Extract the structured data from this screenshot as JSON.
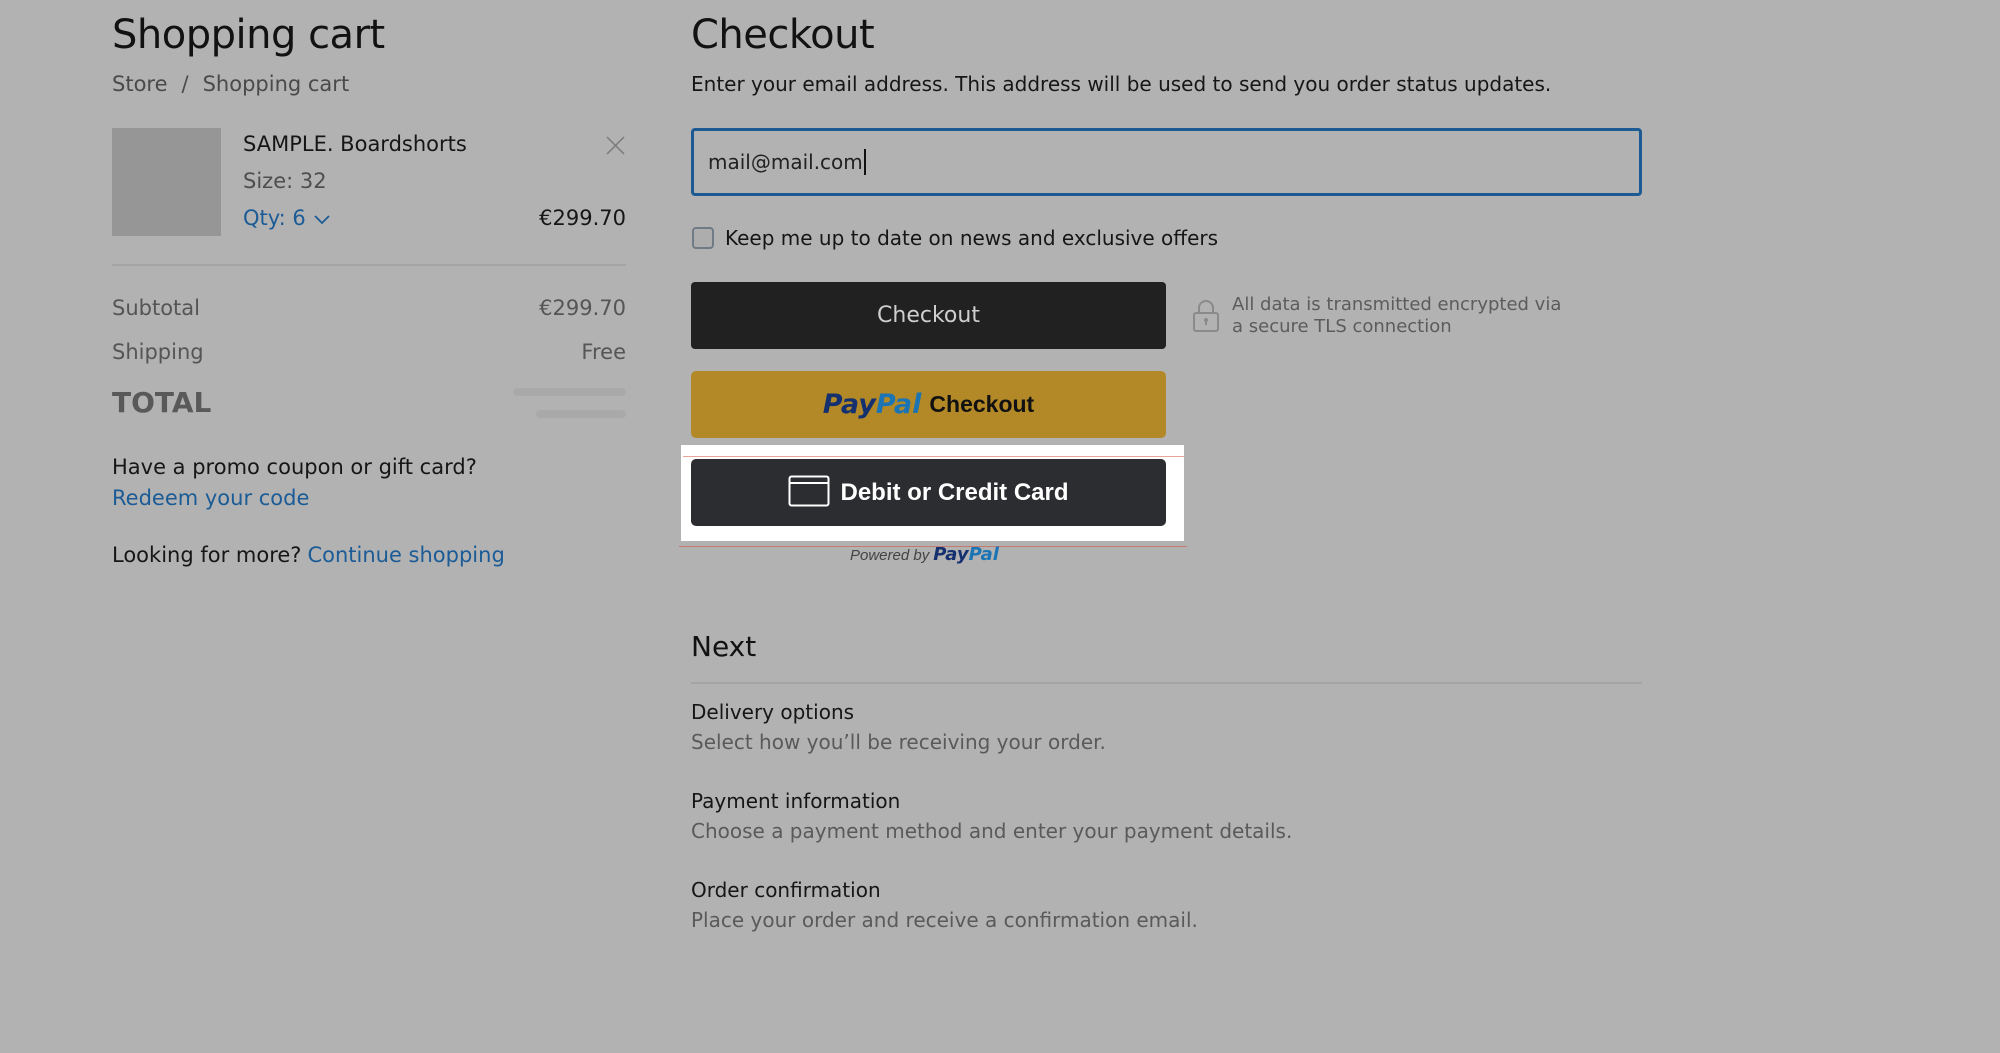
{
  "cart": {
    "title": "Shopping cart",
    "breadcrumb": [
      {
        "label": "Store"
      },
      {
        "label": "Shopping cart"
      }
    ],
    "breadcrumb_separator": "/",
    "item": {
      "name": "SAMPLE. Boardshorts",
      "size": "Size: 32",
      "qty": "Qty: 6",
      "price": "€299.70"
    },
    "summary": {
      "subtotal_label": "Subtotal",
      "subtotal_value": "€299.70",
      "shipping_label": "Shipping",
      "shipping_value": "Free",
      "total_label": "TOTAL"
    },
    "promo": {
      "question": "Have a promo coupon or gift card?",
      "link": "Redeem your code"
    },
    "more": {
      "text": "Looking for more?",
      "link": "Continue shopping"
    }
  },
  "checkout": {
    "title": "Checkout",
    "description": "Enter your email address. This address will be used to send you order status updates.",
    "email_value": "mail@mail.com",
    "newsletter_label": "Keep me up to date on news and exclusive offers",
    "newsletter_checked": false,
    "checkout_button": "Checkout",
    "secure_note_line1": "All data is transmitted encrypted via",
    "secure_note_line2": "a secure TLS connection",
    "paypal": {
      "brand_pay": "Pay",
      "brand_pal": "Pal",
      "checkout_label": "Checkout",
      "card_button": "Debit or Credit Card",
      "powered_by": "Powered by"
    }
  },
  "next": {
    "title": "Next",
    "steps": [
      {
        "title": "Delivery options",
        "desc": "Select how you’ll be receiving your order."
      },
      {
        "title": "Payment information",
        "desc": "Choose a payment method and enter your payment details."
      },
      {
        "title": "Order confirmation",
        "desc": "Place your order and receive a confirmation email."
      }
    ]
  },
  "colors": {
    "background": "#b2b2b2",
    "link": "#1b5b96",
    "paypal_gold": "#b38927",
    "button_dark": "#212121"
  }
}
